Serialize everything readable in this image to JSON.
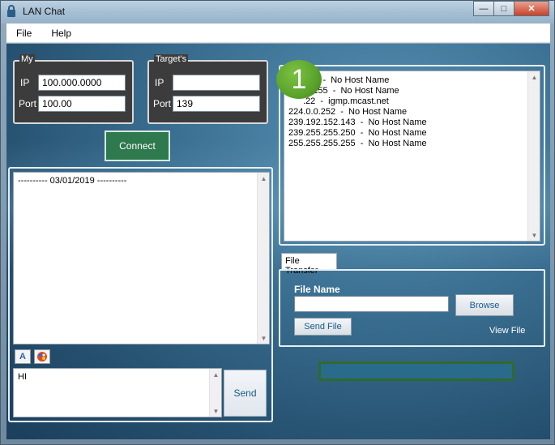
{
  "window": {
    "title": "LAN Chat",
    "minimize": "—",
    "maximize": "□",
    "close": "✕"
  },
  "menu": {
    "items": [
      {
        "label": "File"
      },
      {
        "label": "Help"
      }
    ]
  },
  "my": {
    "group_label": "My",
    "ip_label": "IP",
    "ip_value": "100.000.0000",
    "port_label": "Port",
    "port_value": "100.00"
  },
  "target": {
    "group_label": "Target's",
    "ip_label": "IP",
    "ip_value": "",
    "port_label": "Port",
    "port_value": "139"
  },
  "connect": {
    "label": "Connect"
  },
  "chat": {
    "log_lines": [
      "---------- 03/01/2019 ----------"
    ],
    "message": "HI",
    "send_label": "Send"
  },
  "format_buttons": {
    "font_icon": "font-icon",
    "color_icon": "color-palette-icon"
  },
  "badge": {
    "number": "1"
  },
  "hosts": {
    "items": [
      ".3.1  -  No Host Name",
      ".3.255  -  No Host Name",
      ".22  -  igmp.mcast.net",
      "224.0.0.252  -  No Host Name",
      "239.192.152.143  -  No Host Name",
      "239.255.255.250  -  No Host Name",
      "255.255.255.255  -  No Host Name"
    ]
  },
  "file_transfer": {
    "tab_label": "File Transfer",
    "file_name_label": "File Name",
    "file_name_value": "",
    "browse_label": "Browse",
    "send_file_label": "Send File",
    "view_file_label": "View File"
  },
  "progress": {
    "value": 0
  },
  "colors": {
    "connect": "#2e7a4e",
    "badge": "#5aa32c",
    "progress_border": "#2e6b2e"
  }
}
